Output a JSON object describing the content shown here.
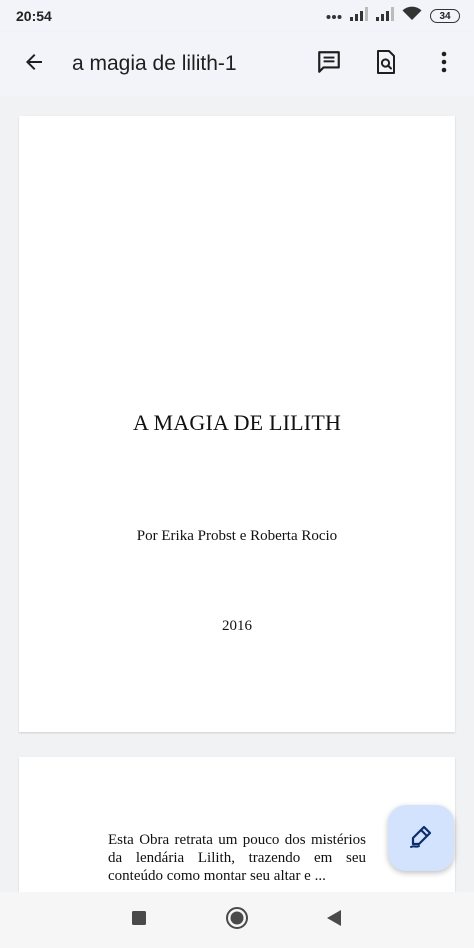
{
  "status_bar": {
    "time": "20:54",
    "battery_level": "34"
  },
  "app_bar": {
    "title": "a magia de lilith-1",
    "icons": [
      "arrow-back-icon",
      "comments-icon",
      "find-in-document-icon",
      "more-vert-icon"
    ]
  },
  "document": {
    "page1": {
      "title": "A MAGIA DE LILITH",
      "authors": "Por Erika Probst e Roberta Rocio",
      "year": "2016"
    },
    "page2": {
      "paragraph": "Esta Obra retrata um pouco dos mistérios da lendária Lilith, trazendo em seu conteúdo como montar seu altar e ..."
    }
  },
  "fab": {
    "icon": "edit-pen-icon"
  },
  "nav_bar": {
    "icons": [
      "recents-square-icon",
      "home-circle-icon",
      "back-triangle-icon"
    ]
  },
  "colors": {
    "fab_bg": "#d3e3fd",
    "bar_bg": "#f3f4f9",
    "canvas_bg": "#f1f2f4"
  }
}
